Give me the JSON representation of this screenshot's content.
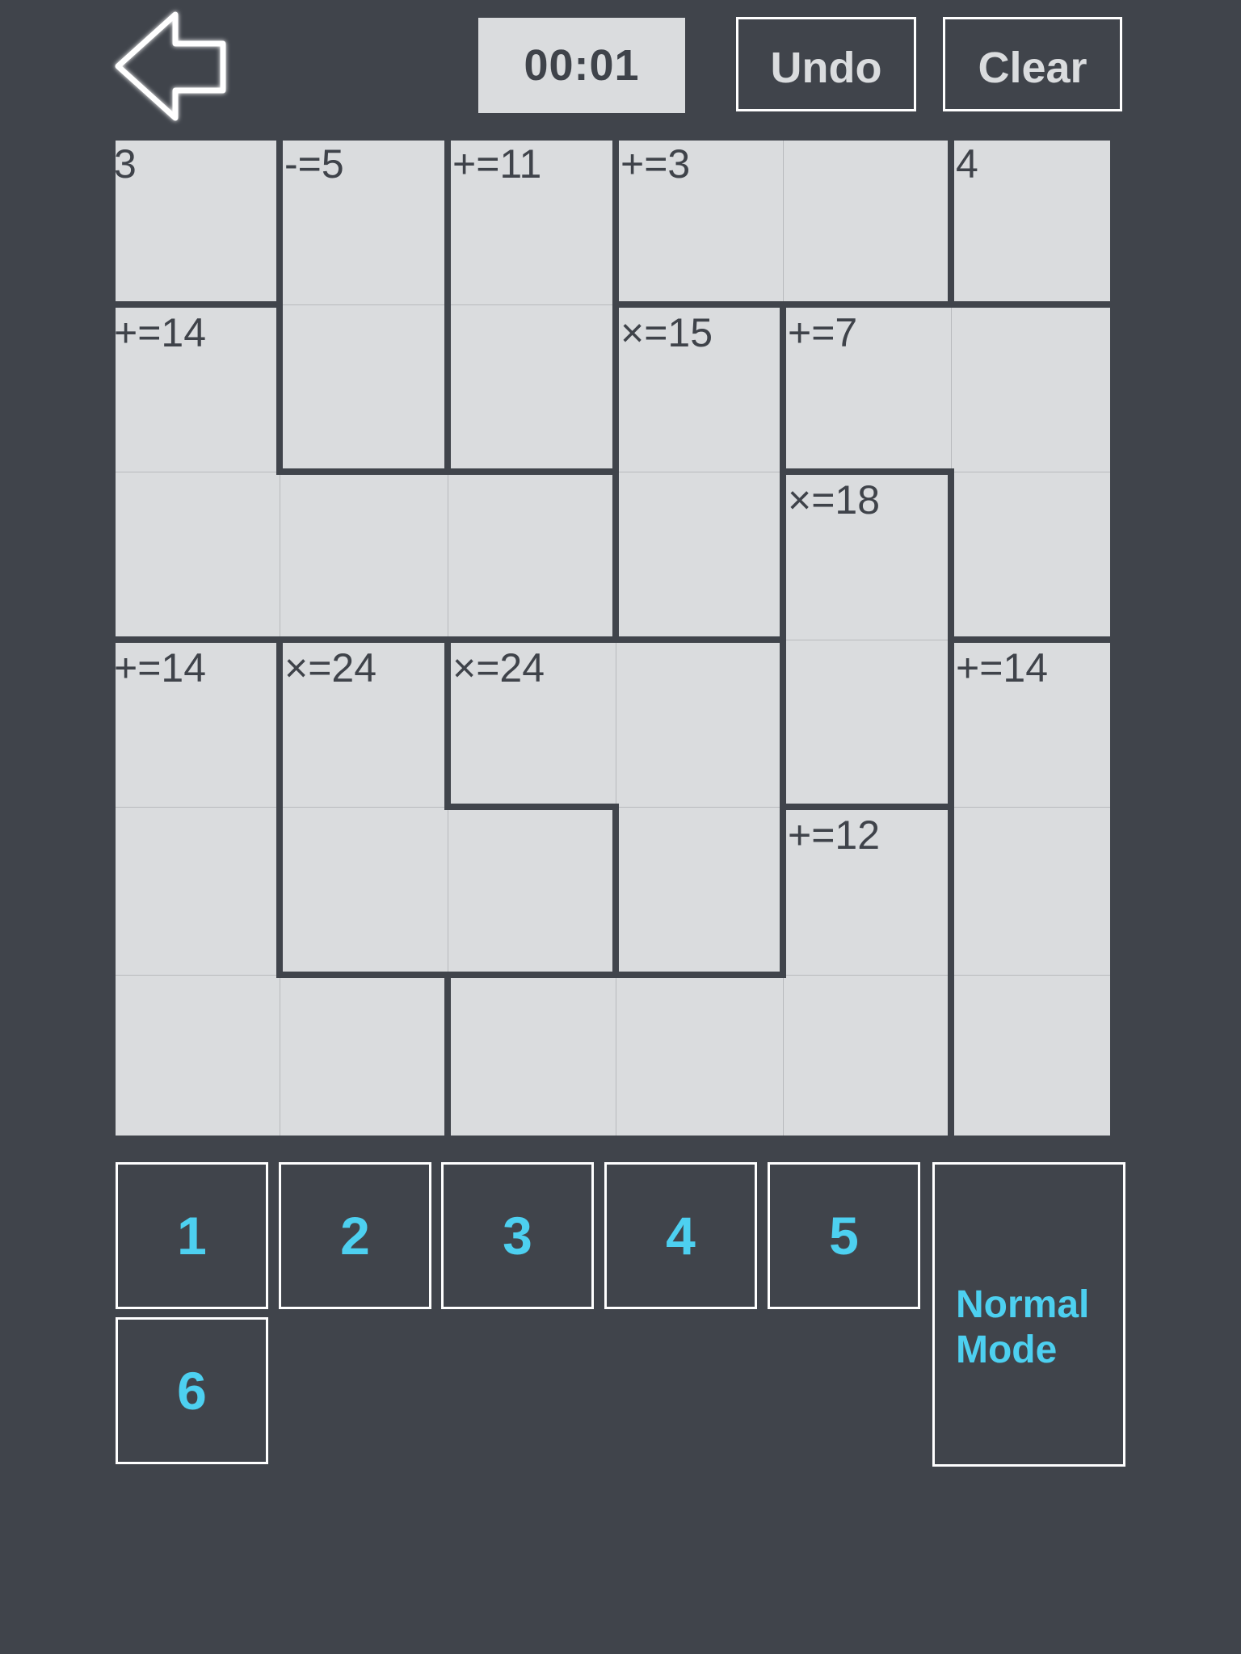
{
  "header": {
    "back_icon": "back-arrow-icon",
    "timer": "00:01",
    "undo_label": "Undo",
    "clear_label": "Clear"
  },
  "puzzle": {
    "size": 6,
    "cages": [
      {
        "id": "A",
        "label": "3",
        "cells": [
          [
            0,
            0
          ]
        ]
      },
      {
        "id": "B",
        "label": "-=5",
        "cells": [
          [
            0,
            1
          ],
          [
            1,
            1
          ]
        ]
      },
      {
        "id": "C",
        "label": "+=11",
        "cells": [
          [
            0,
            2
          ],
          [
            1,
            2
          ]
        ]
      },
      {
        "id": "D",
        "label": "+=3",
        "cells": [
          [
            0,
            3
          ],
          [
            0,
            4
          ]
        ]
      },
      {
        "id": "E",
        "label": "4",
        "cells": [
          [
            0,
            5
          ]
        ]
      },
      {
        "id": "F",
        "label": "+=14",
        "cells": [
          [
            1,
            0
          ],
          [
            2,
            0
          ],
          [
            2,
            1
          ],
          [
            2,
            2
          ]
        ]
      },
      {
        "id": "G",
        "label": "×=15",
        "cells": [
          [
            1,
            3
          ],
          [
            2,
            3
          ]
        ]
      },
      {
        "id": "H",
        "label": "+=7",
        "cells": [
          [
            1,
            4
          ],
          [
            1,
            5
          ],
          [
            2,
            5
          ]
        ]
      },
      {
        "id": "I",
        "label": "×=18",
        "cells": [
          [
            2,
            4
          ],
          [
            3,
            4
          ]
        ]
      },
      {
        "id": "J",
        "label": "+=14",
        "cells": [
          [
            3,
            0
          ],
          [
            4,
            0
          ],
          [
            5,
            0
          ],
          [
            5,
            1
          ]
        ]
      },
      {
        "id": "K",
        "label": "×=24",
        "cells": [
          [
            3,
            1
          ],
          [
            4,
            1
          ],
          [
            4,
            2
          ]
        ]
      },
      {
        "id": "L",
        "label": "×=24",
        "cells": [
          [
            3,
            2
          ],
          [
            3,
            3
          ],
          [
            4,
            3
          ]
        ]
      },
      {
        "id": "M",
        "label": "+=12",
        "cells": [
          [
            4,
            4
          ],
          [
            5,
            2
          ],
          [
            5,
            3
          ],
          [
            5,
            4
          ]
        ]
      },
      {
        "id": "N",
        "label": "+=14",
        "cells": [
          [
            3,
            5
          ],
          [
            4,
            5
          ],
          [
            5,
            5
          ]
        ]
      }
    ],
    "values": [
      [
        "",
        "",
        "",
        "",
        "",
        ""
      ],
      [
        "",
        "",
        "",
        "",
        "",
        ""
      ],
      [
        "",
        "",
        "",
        "",
        "",
        ""
      ],
      [
        "",
        "",
        "",
        "",
        "",
        ""
      ],
      [
        "",
        "",
        "",
        "",
        "",
        ""
      ],
      [
        "",
        "",
        "",
        "",
        "",
        ""
      ]
    ]
  },
  "keypad": {
    "keys": [
      "1",
      "2",
      "3",
      "4",
      "5",
      "6"
    ],
    "mode_label": "Normal Mode"
  },
  "colors": {
    "background": "#40444b",
    "cell": "#dadcde",
    "key_text": "#4dd0f0",
    "border": "#ffffff"
  }
}
